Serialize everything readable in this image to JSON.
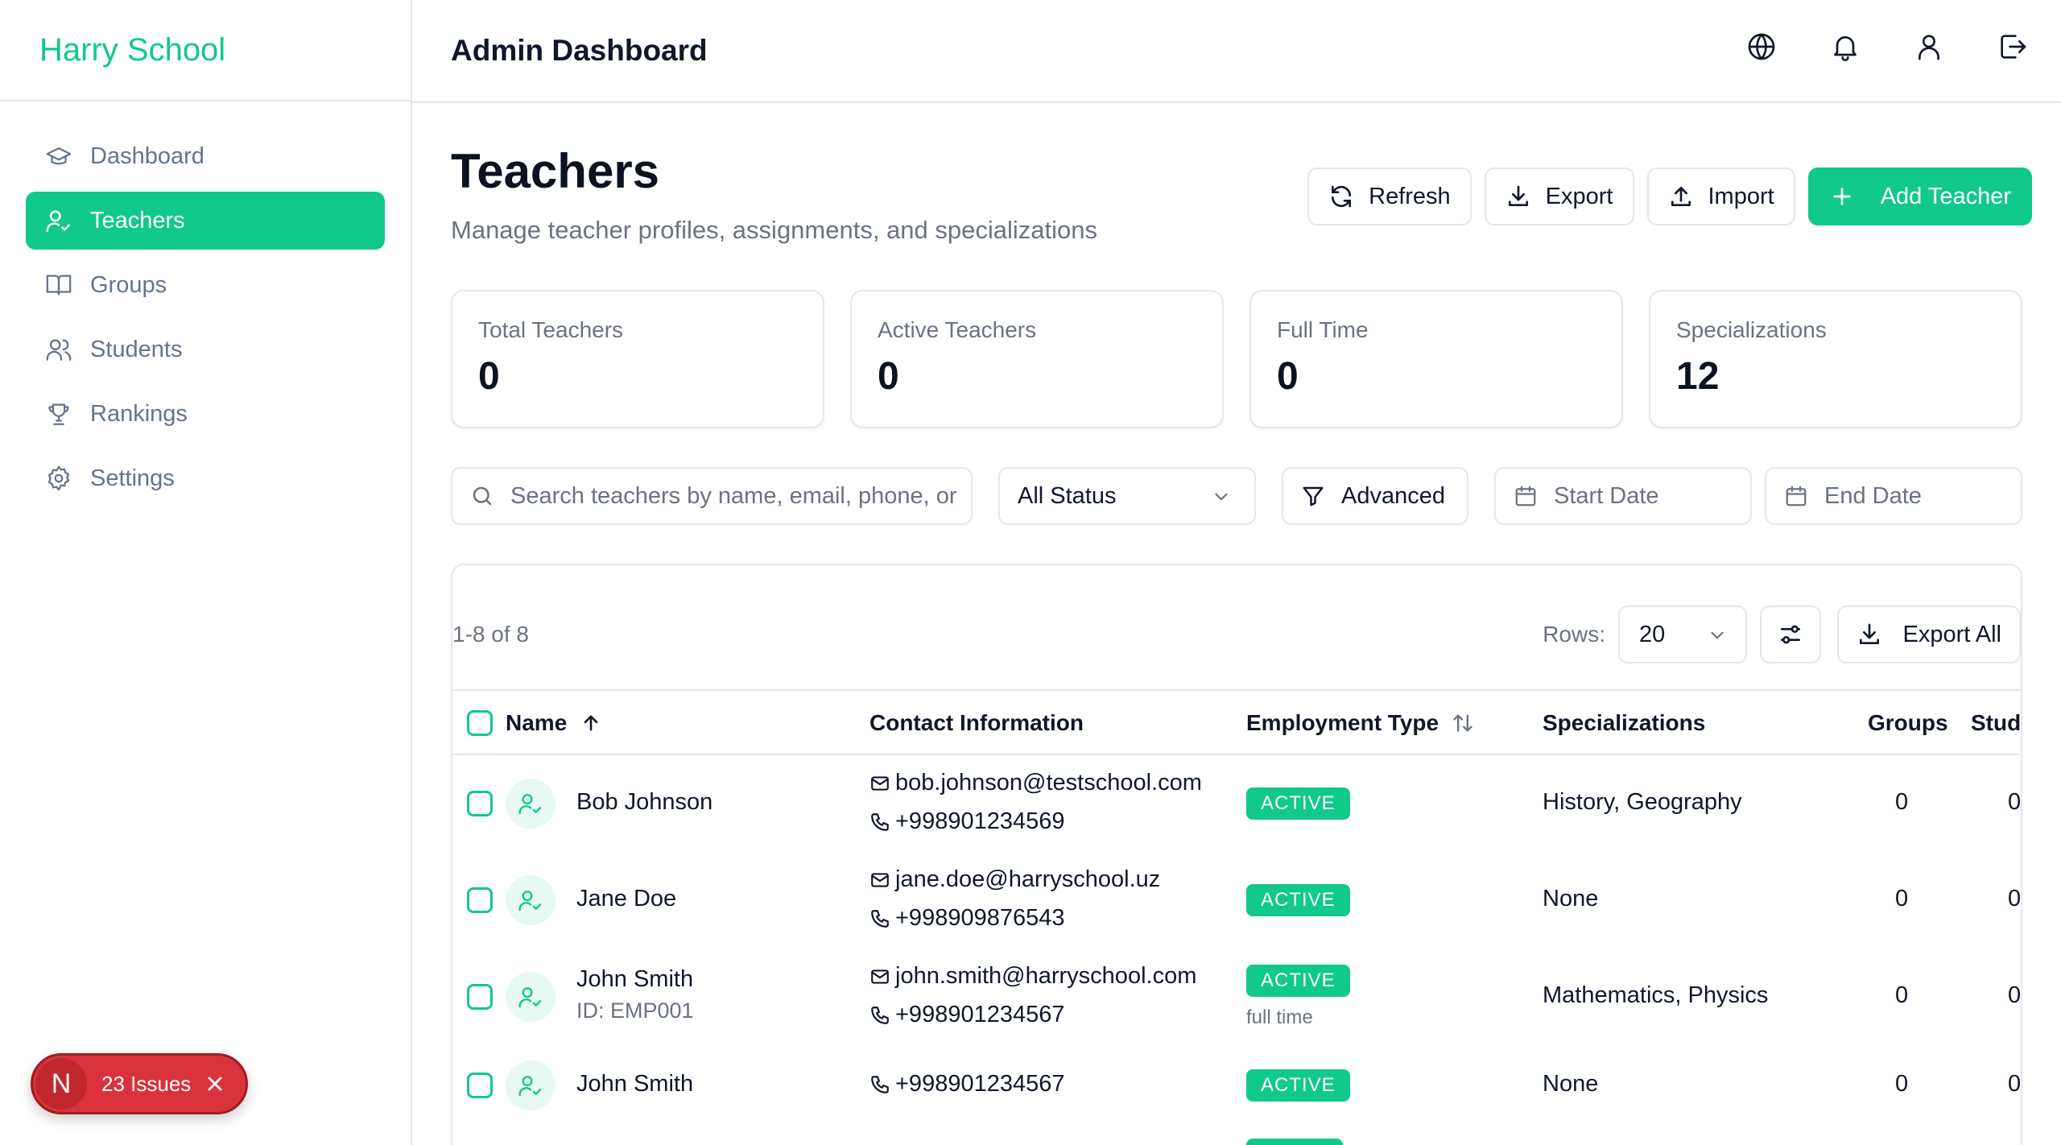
{
  "brand": "Harry School",
  "header": {
    "title": "Admin Dashboard"
  },
  "sidebar": {
    "items": [
      {
        "label": "Dashboard",
        "icon": "graduation-cap-icon"
      },
      {
        "label": "Teachers",
        "icon": "user-check-icon",
        "active": true
      },
      {
        "label": "Groups",
        "icon": "book-open-icon"
      },
      {
        "label": "Students",
        "icon": "users-icon"
      },
      {
        "label": "Rankings",
        "icon": "trophy-icon"
      },
      {
        "label": "Settings",
        "icon": "gear-icon"
      }
    ]
  },
  "page": {
    "title": "Teachers",
    "subtitle": "Manage teacher profiles, assignments, and specializations"
  },
  "actions": {
    "refresh": "Refresh",
    "export": "Export",
    "import": "Import",
    "add": "Add Teacher"
  },
  "stats": [
    {
      "label": "Total Teachers",
      "value": "0"
    },
    {
      "label": "Active Teachers",
      "value": "0"
    },
    {
      "label": "Full Time",
      "value": "0"
    },
    {
      "label": "Specializations",
      "value": "12"
    }
  ],
  "filters": {
    "search_placeholder": "Search teachers by name, email, phone, or",
    "status": "All Status",
    "advanced": "Advanced",
    "start_date": "Start Date",
    "end_date": "End Date"
  },
  "table": {
    "range": "1-8 of 8",
    "rows_label": "Rows:",
    "rows_value": "20",
    "export_all": "Export All",
    "columns": {
      "name": "Name",
      "contact": "Contact Information",
      "employment": "Employment Type",
      "specializations": "Specializations",
      "groups": "Groups",
      "students": "Stud"
    },
    "rows": [
      {
        "name": "Bob Johnson",
        "id": "",
        "email": "bob.johnson@testschool.com",
        "phone": "+998901234569",
        "status": "ACTIVE",
        "type": "",
        "specializations": "History, Geography",
        "groups": "0",
        "students": "0"
      },
      {
        "name": "Jane Doe",
        "id": "",
        "email": "jane.doe@harryschool.uz",
        "phone": "+998909876543",
        "status": "ACTIVE",
        "type": "",
        "specializations": "None",
        "groups": "0",
        "students": "0"
      },
      {
        "name": "John Smith",
        "id": "ID: EMP001",
        "email": "john.smith@harryschool.com",
        "phone": "+998901234567",
        "status": "ACTIVE",
        "type": "full time",
        "specializations": "Mathematics, Physics",
        "groups": "0",
        "students": "0"
      },
      {
        "name": "John Smith",
        "id": "",
        "email": "",
        "phone": "+998901234567",
        "status": "ACTIVE",
        "type": "",
        "specializations": "None",
        "groups": "0",
        "students": "0"
      }
    ]
  },
  "issues": {
    "avatar": "N",
    "label": "23 Issues"
  },
  "colors": {
    "accent": "#10c98b",
    "danger": "#d9323a",
    "muted": "#6b7280",
    "border": "#e5e7eb"
  }
}
